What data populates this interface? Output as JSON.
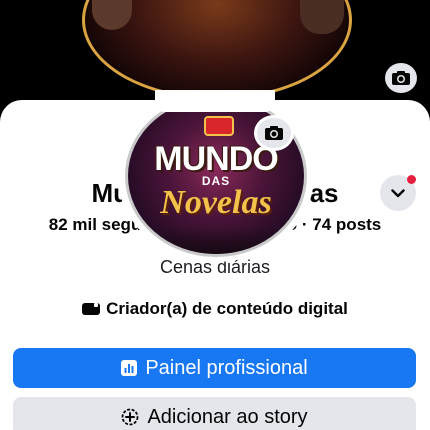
{
  "cover": {
    "camera_icon": "camera-icon"
  },
  "avatar": {
    "logo_line1": "MUNDO",
    "logo_line2": "DAS",
    "logo_line3": "Novelas",
    "camera_icon": "camera-icon"
  },
  "profile": {
    "name": "Mundo Das Novelas",
    "stats": "82 mil seguidores · 2 seguindo · 74 posts",
    "bio": "Cenas diárias",
    "category": "Criador(a) de conteúdo digital",
    "category_icon": "video-camera-icon"
  },
  "actions": {
    "primary_label": "Painel profissional",
    "primary_icon": "bar-chart-icon",
    "secondary_label": "Adicionar ao story",
    "secondary_icon": "add-story-icon"
  },
  "colors": {
    "primary": "#1877f2",
    "secondary_bg": "#e4e6eb",
    "notification": "#e41e3f"
  }
}
